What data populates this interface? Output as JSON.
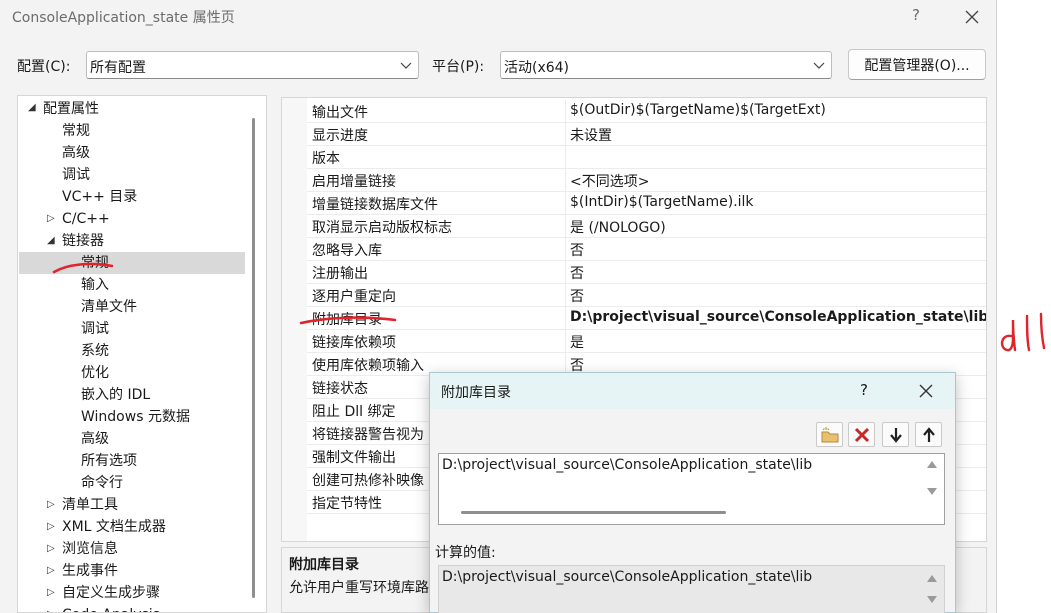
{
  "window": {
    "title": "ConsoleApplication_state 属性页",
    "help_glyph": "?"
  },
  "config_bar": {
    "config_label": "配置(C):",
    "config_value": "所有配置",
    "platform_label": "平台(P):",
    "platform_value": "活动(x64)",
    "manager_button": "配置管理器(O)..."
  },
  "tree": {
    "root": "配置属性",
    "items": [
      {
        "label": "常规"
      },
      {
        "label": "高级"
      },
      {
        "label": "调试"
      },
      {
        "label": "VC++ 目录"
      },
      {
        "label": "C/C++"
      },
      {
        "label": "链接器"
      },
      {
        "label": "常规"
      },
      {
        "label": "输入"
      },
      {
        "label": "清单文件"
      },
      {
        "label": "调试"
      },
      {
        "label": "系统"
      },
      {
        "label": "优化"
      },
      {
        "label": "嵌入的 IDL"
      },
      {
        "label": "Windows 元数据"
      },
      {
        "label": "高级"
      },
      {
        "label": "所有选项"
      },
      {
        "label": "命令行"
      },
      {
        "label": "清单工具"
      },
      {
        "label": "XML 文档生成器"
      },
      {
        "label": "浏览信息"
      },
      {
        "label": "生成事件"
      },
      {
        "label": "自定义生成步骤"
      },
      {
        "label": "Code Analysis"
      }
    ]
  },
  "grid": {
    "rows": [
      {
        "key": "输出文件",
        "value": "$(OutDir)$(TargetName)$(TargetExt)"
      },
      {
        "key": "显示进度",
        "value": "未设置"
      },
      {
        "key": "版本",
        "value": ""
      },
      {
        "key": "启用增量链接",
        "value": "<不同选项>"
      },
      {
        "key": "增量链接数据库文件",
        "value": "$(IntDir)$(TargetName).ilk"
      },
      {
        "key": "取消显示启动版权标志",
        "value": "是 (/NOLOGO)"
      },
      {
        "key": "忽略导入库",
        "value": "否"
      },
      {
        "key": "注册输出",
        "value": "否"
      },
      {
        "key": "逐用户重定向",
        "value": "否"
      },
      {
        "key": "附加库目录",
        "value": "D:\\project\\visual_source\\ConsoleApplication_state\\lib;%"
      },
      {
        "key": "链接库依赖项",
        "value": "是"
      },
      {
        "key": "使用库依赖项输入",
        "value": "否"
      },
      {
        "key": "链接状态",
        "value": ""
      },
      {
        "key": "阻止 Dll 绑定",
        "value": ""
      },
      {
        "key": "将链接器警告视为",
        "value": ""
      },
      {
        "key": "强制文件输出",
        "value": ""
      },
      {
        "key": "创建可热修补映像",
        "value": ""
      },
      {
        "key": "指定节特性",
        "value": ""
      }
    ]
  },
  "description": {
    "title": "附加库目录",
    "text": "允许用户重写环境库路"
  },
  "dialog": {
    "title": "附加库目录",
    "help_glyph": "?",
    "list_items": [
      "D:\\project\\visual_source\\ConsoleApplication_state\\lib"
    ],
    "computed_label": "计算的值:",
    "computed_items": [
      "D:\\project\\visual_source\\ConsoleApplication_state\\lib"
    ]
  },
  "annotation": {
    "handwritten_text": "dll",
    "color": "#e0242b"
  }
}
